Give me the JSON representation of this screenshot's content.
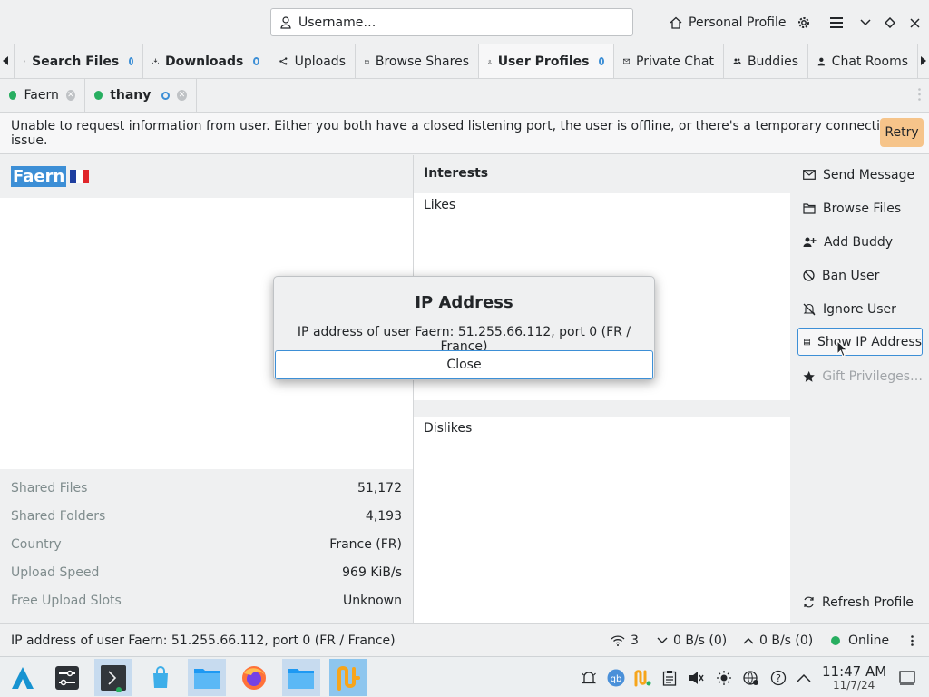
{
  "header": {
    "username_placeholder": "Username…",
    "personal_profile": "Personal Profile"
  },
  "tabs": [
    {
      "label": "Search Files",
      "icon": "search-icon",
      "bold": true,
      "indicator": true
    },
    {
      "label": "Downloads",
      "icon": "download-icon",
      "bold": true,
      "indicator": true
    },
    {
      "label": "Uploads",
      "icon": "upload-icon",
      "bold": false
    },
    {
      "label": "Browse Shares",
      "icon": "folder-icon",
      "bold": false
    },
    {
      "label": "User Profiles",
      "icon": "user-icon",
      "bold": true,
      "indicator": true,
      "active": true
    },
    {
      "label": "Private Chat",
      "icon": "envelope-icon",
      "bold": false
    },
    {
      "label": "Buddies",
      "icon": "buddies-icon",
      "bold": false
    },
    {
      "label": "Chat Rooms",
      "icon": "user-icon",
      "bold": false
    }
  ],
  "user_tabs": [
    {
      "label": "Faern",
      "status": "online"
    },
    {
      "label": "thany",
      "status": "online",
      "bold": true
    }
  ],
  "banner": {
    "message": "Unable to request information from user. Either you both have a closed listening port, the user is offline, or there's a temporary connectivity issue.",
    "retry": "Retry"
  },
  "profile": {
    "username": "Faern",
    "stats": [
      {
        "label": "Shared Files",
        "value": "51,172"
      },
      {
        "label": "Shared Folders",
        "value": "4,193"
      },
      {
        "label": "Country",
        "value": "France (FR)"
      },
      {
        "label": "Upload Speed",
        "value": "969 KiB/s"
      },
      {
        "label": "Free Upload Slots",
        "value": "Unknown"
      }
    ]
  },
  "interests": {
    "title": "Interests",
    "likes": "Likes",
    "dislikes": "Dislikes"
  },
  "actions": [
    {
      "label": "Send Message",
      "icon": "envelope-icon"
    },
    {
      "label": "Browse Files",
      "icon": "folder-icon"
    },
    {
      "label": "Add Buddy",
      "icon": "add-buddy-icon"
    },
    {
      "label": "Ban User",
      "icon": "ban-icon"
    },
    {
      "label": "Ignore User",
      "icon": "ignore-icon"
    },
    {
      "label": "Show IP Address",
      "icon": "ip-icon",
      "focused": true
    },
    {
      "label": "Gift Privileges…",
      "icon": "star-icon",
      "disabled": true
    }
  ],
  "refresh": "Refresh Profile",
  "dialog": {
    "title": "IP Address",
    "text": "IP address of user Faern: 51.255.66.112, port 0 (FR / France)",
    "close": "Close"
  },
  "statusbar": {
    "message": "IP address of user Faern: 51.255.66.112, port 0 (FR / France)",
    "connections": "3",
    "download": "0 B/s (0)",
    "upload": "0 B/s (0)",
    "status": "Online"
  },
  "clock": {
    "time": "11:47 AM",
    "date": "11/7/24"
  },
  "colors": {
    "accent": "#3d8fd6",
    "online": "#27ae60",
    "retry": "#f6c48a"
  }
}
